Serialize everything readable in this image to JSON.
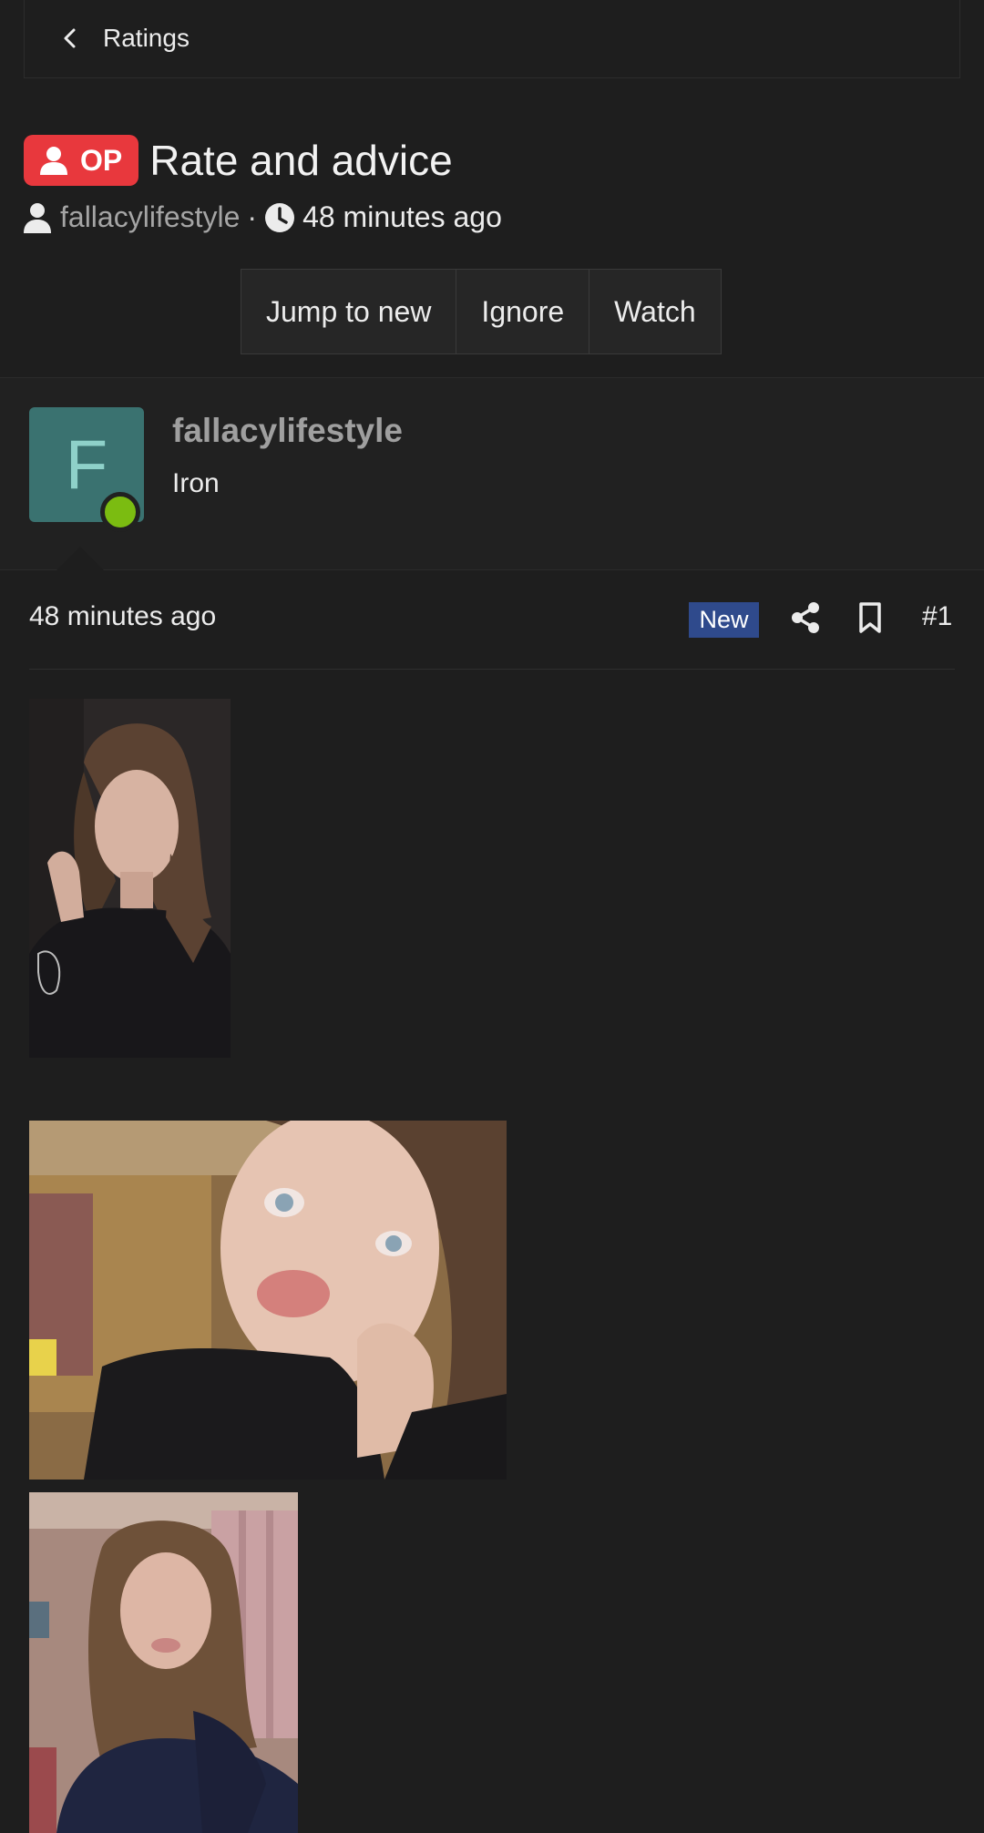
{
  "breadcrumb": {
    "label": "Ratings"
  },
  "thread": {
    "op_badge": "OP",
    "title": "Rate and advice",
    "author": "fallacylifestyle",
    "separator": "·",
    "time": "48 minutes ago"
  },
  "actions": {
    "jump_to_new": "Jump to new",
    "ignore": "Ignore",
    "watch": "Watch"
  },
  "poster": {
    "avatar_letter": "F",
    "name": "fallacylifestyle",
    "title": "Iron",
    "status": "online"
  },
  "post": {
    "time": "48 minutes ago",
    "new_badge": "New",
    "number": "#1",
    "images": [
      {
        "alt": "selfie in black hoodie"
      },
      {
        "alt": "close-up selfie with pursed lips"
      },
      {
        "alt": "selfie in navy top"
      }
    ]
  },
  "colors": {
    "background": "#1e1e1e",
    "op_badge": "#e8383d",
    "new_badge": "#2f4a8c",
    "avatar_bg": "#3a7270",
    "online": "#7bbc11"
  },
  "icons": {
    "back": "chevron-left-icon",
    "op": "user-icon",
    "author": "user-icon",
    "time": "clock-icon",
    "share": "share-icon",
    "bookmark": "bookmark-icon"
  }
}
